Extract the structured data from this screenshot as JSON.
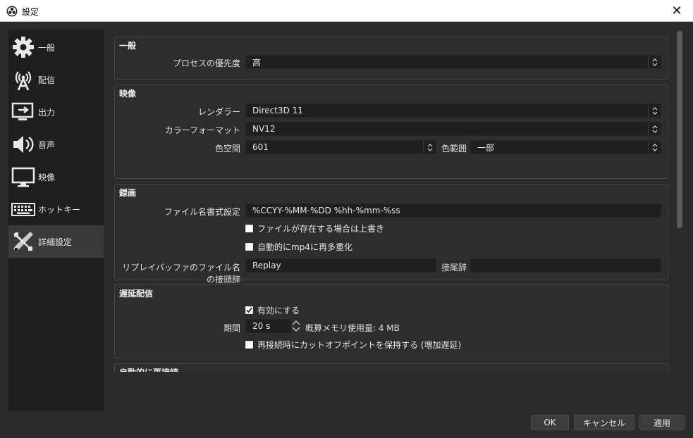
{
  "window": {
    "title": "設定",
    "close": "✕"
  },
  "sidebar": {
    "items": [
      {
        "label": "一般",
        "icon": "gear-icon"
      },
      {
        "label": "配信",
        "icon": "broadcast-icon"
      },
      {
        "label": "出力",
        "icon": "output-icon"
      },
      {
        "label": "音声",
        "icon": "speaker-icon"
      },
      {
        "label": "映像",
        "icon": "monitor-icon"
      },
      {
        "label": "ホットキー",
        "icon": "keyboard-icon"
      },
      {
        "label": "詳細設定",
        "icon": "tools-icon",
        "active": true
      }
    ]
  },
  "general": {
    "title": "一般",
    "process_priority_label": "プロセスの優先度",
    "process_priority_value": "高"
  },
  "video": {
    "title": "映像",
    "renderer_label": "レンダラー",
    "renderer_value": "Direct3D 11",
    "color_format_label": "カラーフォーマット",
    "color_format_value": "NV12",
    "color_space_label": "色空間",
    "color_space_value": "601",
    "color_range_label": "色範囲",
    "color_range_value": "一部"
  },
  "recording": {
    "title": "録画",
    "filename_format_label": "ファイル名書式設定",
    "filename_format_value": "%CCYY-%MM-%DD %hh-%mm-%ss",
    "overwrite_label": "ファイルが存在する場合は上書き",
    "remux_label": "自動的にmp4に再多重化",
    "replay_prefix_label": "リプレイバッファのファイル名の接頭辞",
    "replay_prefix_value": "Replay",
    "suffix_label": "接尾辞",
    "suffix_value": ""
  },
  "stream_delay": {
    "title": "遅延配信",
    "enable_label": "有効にする",
    "duration_label": "期間",
    "duration_value": "20 s",
    "memory_usage_label": "概算メモリ使用量: 4 MB",
    "preserve_label": "再接続時にカットオフポイントを保持する (増加遅延)"
  },
  "reconnect": {
    "title": "自動的に再接続"
  },
  "buttons": {
    "ok": "OK",
    "cancel": "キャンセル",
    "apply": "適用"
  }
}
